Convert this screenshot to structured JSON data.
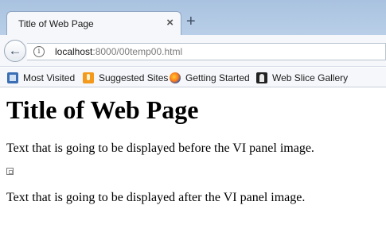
{
  "browser": {
    "tab": {
      "title": "Title of Web Page",
      "close_glyph": "×"
    },
    "new_tab_glyph": "+",
    "nav": {
      "back_glyph": "←",
      "info_glyph": "i",
      "url_host": "localhost",
      "url_rest": ":8000/00temp00.html"
    },
    "bookmarks": [
      {
        "label": "Most Visited",
        "icon": "most-visited-icon"
      },
      {
        "label": "Suggested Sites",
        "icon": "suggested-sites-icon"
      },
      {
        "label": "Getting Started",
        "icon": "firefox-icon"
      },
      {
        "label": "Web Slice Gallery",
        "icon": "web-slice-icon"
      }
    ]
  },
  "page": {
    "heading": "Title of Web Page",
    "paragraph_before": "Text that is going to be displayed before the VI panel image.",
    "image_icon": "broken-image-icon",
    "paragraph_after": "Text that is going to be displayed after the VI panel image."
  }
}
